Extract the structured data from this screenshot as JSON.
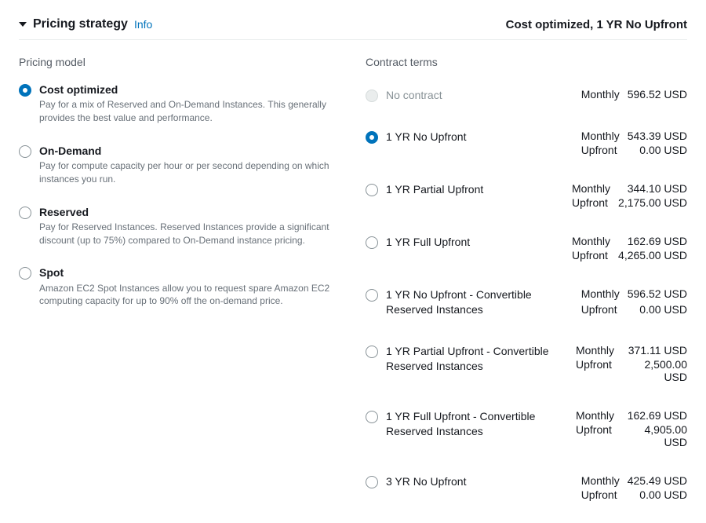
{
  "header": {
    "title": "Pricing strategy",
    "info_label": "Info",
    "summary": "Cost optimized, 1 YR No Upfront"
  },
  "pricing_model": {
    "heading": "Pricing model",
    "options": [
      {
        "id": "cost-optimized",
        "label": "Cost optimized",
        "desc": "Pay for a mix of Reserved and On-Demand Instances. This generally provides the best value and performance.",
        "selected": true
      },
      {
        "id": "on-demand",
        "label": "On-Demand",
        "desc": "Pay for compute capacity per hour or per second depending on which instances you run.",
        "selected": false
      },
      {
        "id": "reserved",
        "label": "Reserved",
        "desc": "Pay for Reserved Instances. Reserved Instances provide a significant discount (up to 75%) compared to On-Demand instance pricing.",
        "selected": false
      },
      {
        "id": "spot",
        "label": "Spot",
        "desc": "Amazon EC2 Spot Instances allow you to request spare Amazon EC2 computing capacity for up to 90% off the on-demand price.",
        "selected": false
      }
    ]
  },
  "contract_terms": {
    "heading": "Contract terms",
    "options": [
      {
        "id": "no-contract",
        "label": "No contract",
        "disabled": true,
        "selected": false,
        "prices": [
          {
            "label": "Monthly",
            "value": "596.52 USD"
          }
        ]
      },
      {
        "id": "1yr-no-upfront",
        "label": "1 YR No Upfront",
        "disabled": false,
        "selected": true,
        "prices": [
          {
            "label": "Monthly",
            "value": "543.39 USD"
          },
          {
            "label": "Upfront",
            "value": "0.00 USD"
          }
        ]
      },
      {
        "id": "1yr-partial-upfront",
        "label": "1 YR Partial Upfront",
        "disabled": false,
        "selected": false,
        "prices": [
          {
            "label": "Monthly",
            "value": "344.10 USD"
          },
          {
            "label": "Upfront",
            "value": "2,175.00 USD"
          }
        ]
      },
      {
        "id": "1yr-full-upfront",
        "label": "1 YR Full Upfront",
        "disabled": false,
        "selected": false,
        "prices": [
          {
            "label": "Monthly",
            "value": "162.69 USD"
          },
          {
            "label": "Upfront",
            "value": "4,265.00 USD"
          }
        ]
      },
      {
        "id": "1yr-no-upfront-conv",
        "label": "1 YR No Upfront - Convertible Reserved Instances",
        "disabled": false,
        "selected": false,
        "prices": [
          {
            "label": "Monthly",
            "value": "596.52 USD"
          },
          {
            "label": "Upfront",
            "value": "0.00 USD"
          }
        ]
      },
      {
        "id": "1yr-partial-upfront-conv",
        "label": "1 YR Partial Upfront - Convertible Reserved Instances",
        "disabled": false,
        "selected": false,
        "prices": [
          {
            "label": "Monthly",
            "value": "371.11 USD"
          },
          {
            "label": "Upfront",
            "value": "2,500.00 USD"
          }
        ]
      },
      {
        "id": "1yr-full-upfront-conv",
        "label": "1 YR Full Upfront - Convertible Reserved Instances",
        "disabled": false,
        "selected": false,
        "prices": [
          {
            "label": "Monthly",
            "value": "162.69 USD"
          },
          {
            "label": "Upfront",
            "value": "4,905.00 USD"
          }
        ]
      },
      {
        "id": "3yr-no-upfront",
        "label": "3 YR No Upfront",
        "disabled": false,
        "selected": false,
        "prices": [
          {
            "label": "Monthly",
            "value": "425.49 USD"
          },
          {
            "label": "Upfront",
            "value": "0.00 USD"
          }
        ]
      }
    ]
  }
}
